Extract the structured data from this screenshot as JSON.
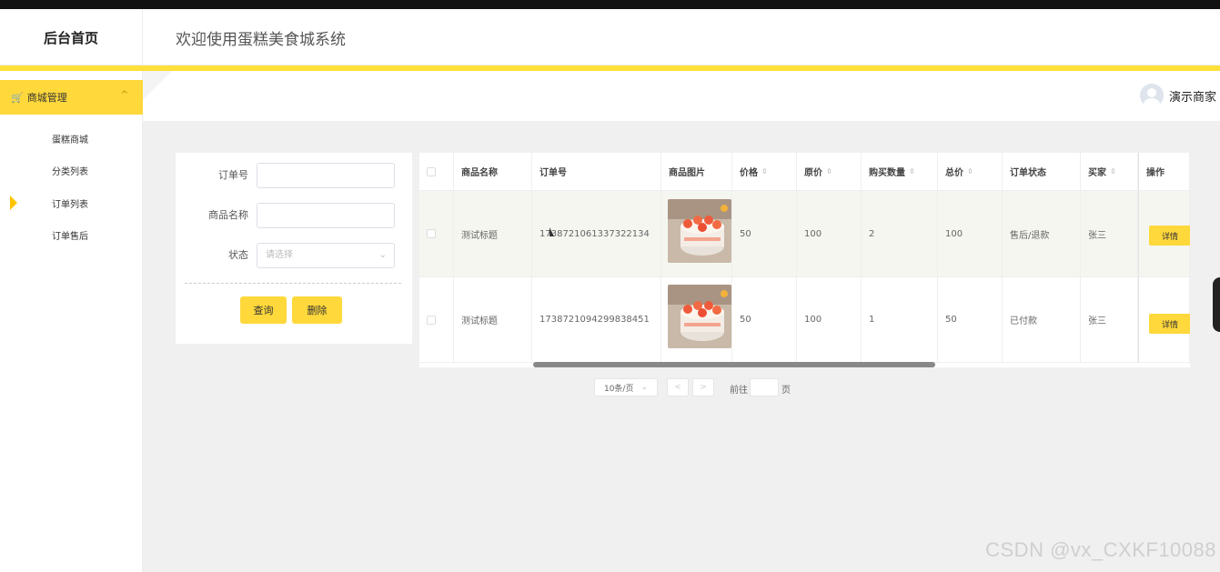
{
  "header": {
    "brand": "后台首页",
    "welcome": "欢迎使用蛋糕美食城系统"
  },
  "sidebar": {
    "group_label": "商城管理",
    "items": [
      {
        "label": "蛋糕商城"
      },
      {
        "label": "分类列表"
      },
      {
        "label": "订单列表",
        "active": true
      },
      {
        "label": "订单售后"
      }
    ]
  },
  "user": {
    "name": "演示商家"
  },
  "search": {
    "order_no_label": "订单号",
    "order_no_value": "",
    "product_name_label": "商品名称",
    "product_name_value": "",
    "status_label": "状态",
    "status_placeholder": "请选择",
    "query_button": "查询",
    "delete_button": "删除"
  },
  "table": {
    "columns": [
      "商品名称",
      "订单号",
      "商品图片",
      "价格",
      "原价",
      "购买数量",
      "总价",
      "订单状态",
      "买家",
      "操作"
    ],
    "sortable": [
      "价格",
      "原价",
      "购买数量",
      "总价",
      "买家"
    ],
    "rows": [
      {
        "product_name": "测试标题",
        "order_no": "1738721061337322134",
        "price": "50",
        "original_price": "100",
        "quantity": "2",
        "total": "100",
        "status": "售后/退款",
        "buyer": "张三",
        "action": "详情"
      },
      {
        "product_name": "测试标题",
        "order_no": "1738721094299838451",
        "price": "50",
        "original_price": "100",
        "quantity": "1",
        "total": "50",
        "status": "已付款",
        "buyer": "张三",
        "action": "详情"
      }
    ]
  },
  "pagination": {
    "page_size": "10条/页",
    "prev": "<",
    "next": ">",
    "goto_label": "前往",
    "page_unit": "页"
  },
  "watermark": "CSDN @vx_CXKF10088",
  "colors": {
    "accent": "#ffd83b",
    "topbar": "#111111"
  }
}
